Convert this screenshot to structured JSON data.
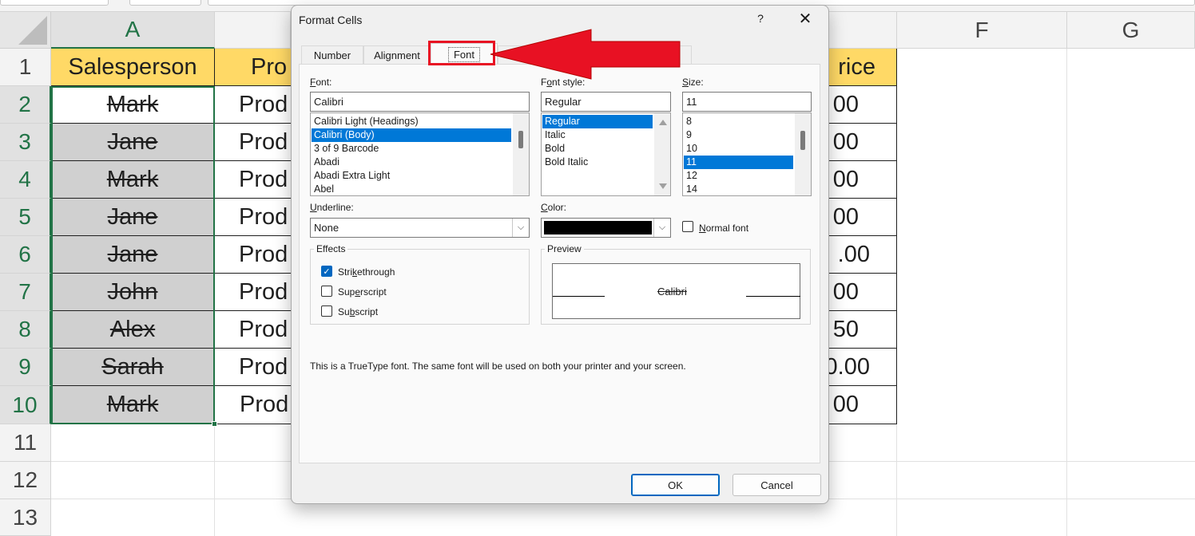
{
  "sheet": {
    "columns": [
      "A",
      "F",
      "G"
    ],
    "rows": [
      "1",
      "2",
      "3",
      "4",
      "5",
      "6",
      "7",
      "8",
      "9",
      "10",
      "11",
      "12",
      "13"
    ],
    "header_row": {
      "salesperson": "Salesperson",
      "product_partial": "Pro",
      "price_partial": "rice"
    },
    "salespeople": [
      "Mark",
      "Jane",
      "Mark",
      "Jane",
      "Jane",
      "John",
      "Alex",
      "Sarah",
      "Mark"
    ],
    "product_partial": [
      "Prod",
      "Prod",
      "Prod",
      "Prod",
      "Prod",
      "Prod",
      "Prod",
      "Prod",
      "Prod"
    ],
    "price_partial": [
      "00",
      "00",
      "00",
      "00",
      ".00",
      "00",
      "50",
      "0.00",
      "00"
    ],
    "colors": {
      "header_fill": "#ffd966",
      "strike_fill": "#d0d0d0",
      "selection": "#217346"
    }
  },
  "dialog": {
    "title": "Format Cells",
    "help": "?",
    "close": "✕",
    "tabs": [
      "Number",
      "Alignment",
      "Font"
    ],
    "active_tab": "Font",
    "font": {
      "label_pre": "",
      "label_key": "F",
      "label_post": "ont:",
      "value": "Calibri",
      "list": [
        "Calibri Light (Headings)",
        "Calibri (Body)",
        "3 of 9 Barcode",
        "Abadi",
        "Abadi Extra Light",
        "Abel"
      ],
      "selected_index": 1
    },
    "font_style": {
      "label_pre": "F",
      "label_key": "o",
      "label_post": "nt style:",
      "value": "Regular",
      "list": [
        "Regular",
        "Italic",
        "Bold",
        "Bold Italic"
      ],
      "selected_index": 0
    },
    "size": {
      "label_pre": "",
      "label_key": "S",
      "label_post": "ize:",
      "value": "11",
      "list": [
        "8",
        "9",
        "10",
        "11",
        "12",
        "14"
      ],
      "selected_index": 3
    },
    "underline": {
      "label_pre": "",
      "label_key": "U",
      "label_post": "nderline:",
      "value": "None"
    },
    "color": {
      "label_pre": "",
      "label_key": "C",
      "label_post": "olor:",
      "swatch": "#000000"
    },
    "normal_font": {
      "label_pre": "",
      "label_key": "N",
      "label_post": "ormal font",
      "checked": false
    },
    "effects": {
      "title": "Effects",
      "strikethrough": {
        "pre": "Stri",
        "key": "k",
        "post": "ethrough",
        "checked": true
      },
      "superscript": {
        "pre": "Sup",
        "key": "e",
        "post": "rscript",
        "checked": false
      },
      "subscript": {
        "pre": "Su",
        "key": "b",
        "post": "script",
        "checked": false
      }
    },
    "preview": {
      "title": "Preview",
      "sample": "Calibri"
    },
    "info": "This is a TrueType font.  The same font will be used on both your printer and your screen.",
    "ok": "OK",
    "cancel": "Cancel",
    "checkmark": "✓",
    "dropdown_glyph": "⌵"
  },
  "annotation": {
    "color": "#e81123"
  }
}
